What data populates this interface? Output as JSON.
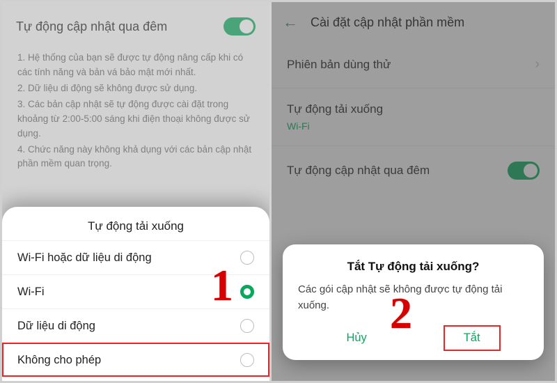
{
  "left": {
    "autoUpdateLabel": "Tự động cập nhật qua đêm",
    "notes": [
      "1. Hệ thống của bạn sẽ được tự động nâng cấp khi có các tính năng và bản vá bảo mật mới nhất.",
      "2. Dữ liệu di động sẽ không được sử dụng.",
      "3. Các bản cập nhật sẽ tự động được cài đặt trong khoảng từ 2:00-5:00 sáng khi điện thoại không được sử dụng.",
      "4. Chức năng này không khả dụng với các bản cập nhật phần mềm quan trọng."
    ],
    "sheetTitle": "Tự động tải xuống",
    "options": [
      {
        "label": "Wi-Fi hoặc dữ liệu di động",
        "selected": false
      },
      {
        "label": "Wi-Fi",
        "selected": true
      },
      {
        "label": "Dữ liệu di động",
        "selected": false
      },
      {
        "label": "Không cho phép",
        "selected": false
      }
    ],
    "marker": "1"
  },
  "right": {
    "headerTitle": "Cài đặt cập nhật phần mềm",
    "item1": "Phiên bản dùng thử",
    "autoDownloadLabel": "Tự động tải xuống",
    "autoDownloadValue": "Wi-Fi",
    "autoUpdateLabel": "Tự động cập nhật qua đêm",
    "dialog": {
      "title": "Tắt Tự động tải xuống?",
      "body": "Các gói cập nhật sẽ không được tự động tải xuống.",
      "cancel": "Hủy",
      "confirm": "Tắt"
    },
    "marker": "2"
  }
}
